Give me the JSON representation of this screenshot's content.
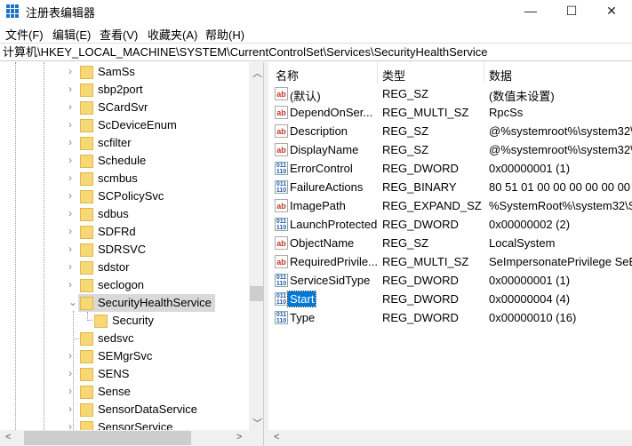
{
  "window": {
    "title": "注册表编辑器",
    "minimize": "—",
    "maximize": "☐",
    "close": "✕"
  },
  "menu": [
    "文件(F)",
    "编辑(E)",
    "查看(V)",
    "收藏夹(A)",
    "帮助(H)"
  ],
  "address": "计算机\\HKEY_LOCAL_MACHINE\\SYSTEM\\CurrentControlSet\\Services\\SecurityHealthService",
  "tree": [
    {
      "label": "SamSs",
      "expander": "›"
    },
    {
      "label": "sbp2port",
      "expander": "›"
    },
    {
      "label": "SCardSvr",
      "expander": "›"
    },
    {
      "label": "ScDeviceEnum",
      "expander": "›"
    },
    {
      "label": "scfilter",
      "expander": "›"
    },
    {
      "label": "Schedule",
      "expander": "›"
    },
    {
      "label": "scmbus",
      "expander": "›"
    },
    {
      "label": "SCPolicySvc",
      "expander": "›"
    },
    {
      "label": "sdbus",
      "expander": "›"
    },
    {
      "label": "SDFRd",
      "expander": "›"
    },
    {
      "label": "SDRSVC",
      "expander": "›"
    },
    {
      "label": "sdstor",
      "expander": "›"
    },
    {
      "label": "seclogon",
      "expander": "›"
    },
    {
      "label": "SecurityHealthService",
      "expander": "⌄",
      "selected": true
    },
    {
      "label": "Security",
      "child": true
    },
    {
      "label": "sedsvc",
      "expander": ""
    },
    {
      "label": "SEMgrSvc",
      "expander": "›"
    },
    {
      "label": "SENS",
      "expander": "›"
    },
    {
      "label": "Sense",
      "expander": "›"
    },
    {
      "label": "SensorDataService",
      "expander": "›"
    },
    {
      "label": "SensorService",
      "expander": "›"
    }
  ],
  "columns": {
    "name": "名称",
    "type": "类型",
    "data": "数据"
  },
  "values": [
    {
      "name": "(默认)",
      "type": "REG_SZ",
      "data": "(数值未设置)",
      "icon": "string"
    },
    {
      "name": "DependOnSer...",
      "type": "REG_MULTI_SZ",
      "data": "RpcSs",
      "icon": "string"
    },
    {
      "name": "Description",
      "type": "REG_SZ",
      "data": "@%systemroot%\\system32\\",
      "icon": "string"
    },
    {
      "name": "DisplayName",
      "type": "REG_SZ",
      "data": "@%systemroot%\\system32\\",
      "icon": "string"
    },
    {
      "name": "ErrorControl",
      "type": "REG_DWORD",
      "data": "0x00000001 (1)",
      "icon": "binary"
    },
    {
      "name": "FailureActions",
      "type": "REG_BINARY",
      "data": "80 51 01 00 00 00 00 00 00",
      "icon": "binary"
    },
    {
      "name": "ImagePath",
      "type": "REG_EXPAND_SZ",
      "data": "%SystemRoot%\\system32\\S",
      "icon": "string"
    },
    {
      "name": "LaunchProtected",
      "type": "REG_DWORD",
      "data": "0x00000002 (2)",
      "icon": "binary"
    },
    {
      "name": "ObjectName",
      "type": "REG_SZ",
      "data": "LocalSystem",
      "icon": "string"
    },
    {
      "name": "RequiredPrivile...",
      "type": "REG_MULTI_SZ",
      "data": "SeImpersonatePrivilege SeB",
      "icon": "string"
    },
    {
      "name": "ServiceSidType",
      "type": "REG_DWORD",
      "data": "0x00000001 (1)",
      "icon": "binary"
    },
    {
      "name": "Start",
      "type": "REG_DWORD",
      "data": "0x00000004 (4)",
      "icon": "binary",
      "selected": true
    },
    {
      "name": "Type",
      "type": "REG_DWORD",
      "data": "0x00000010 (16)",
      "icon": "binary"
    }
  ]
}
